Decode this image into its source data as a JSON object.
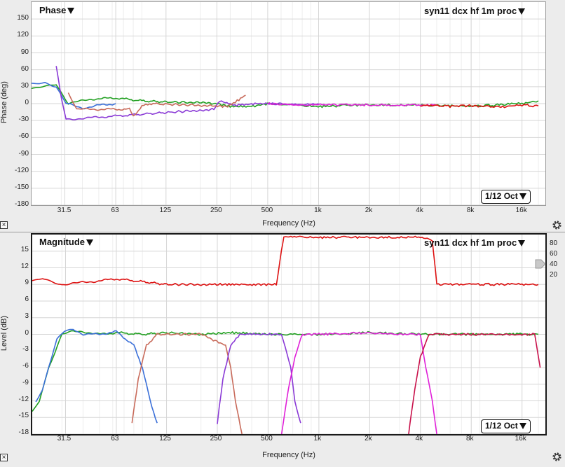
{
  "phase_panel": {
    "title": "Phase",
    "measurement": "syn11 dcx hf 1m proc",
    "smoothing": "1/12 Oct",
    "y_label": "Phase (deg)",
    "x_label": "Frequency (Hz)",
    "y_ticks": [
      "150",
      "120",
      "90",
      "60",
      "30",
      "0",
      "-30",
      "-60",
      "-90",
      "-120",
      "-150",
      "-180"
    ],
    "x_ticks": [
      "31.5",
      "63",
      "125",
      "250",
      "500",
      "1k",
      "2k",
      "4k",
      "8k",
      "16k"
    ]
  },
  "magnitude_panel": {
    "title": "Magnitude",
    "measurement": "syn11 dcx hf 1m proc",
    "smoothing": "1/12 Oct",
    "y_label": "Level (dB)",
    "x_label": "Frequency (Hz)",
    "y_ticks": [
      "15",
      "12",
      "9",
      "6",
      "3",
      "0",
      "-3",
      "-6",
      "-9",
      "-12",
      "-15",
      "-18"
    ],
    "right_ticks": [
      "80",
      "60",
      "40",
      "20"
    ],
    "x_ticks": [
      "31.5",
      "63",
      "125",
      "250",
      "500",
      "1k",
      "2k",
      "4k",
      "8k",
      "16k"
    ]
  },
  "colors": {
    "red": "#dd1111",
    "green": "#22a022",
    "blue": "#3a6fd8",
    "purple": "#8a3ad6",
    "magenta": "#e020d8",
    "salmon": "#c86a5a",
    "crimson": "#c8104a"
  },
  "chart_data": [
    {
      "type": "line",
      "title": "Phase",
      "xlabel": "Frequency (Hz)",
      "ylabel": "Phase (deg)",
      "x_scale": "log",
      "xlim": [
        20,
        22000
      ],
      "ylim": [
        -180,
        180
      ],
      "grid": true,
      "series": [
        {
          "color": "green",
          "x": [
            20,
            28,
            33,
            45,
            63,
            90,
            125,
            180,
            250,
            300,
            400,
            500,
            700,
            1000,
            2000,
            4000,
            8000,
            16000,
            20000
          ],
          "y": [
            25,
            35,
            0,
            8,
            10,
            5,
            3,
            2,
            0,
            -5,
            -5,
            0,
            -3,
            -5,
            -2,
            -3,
            -5,
            0,
            5
          ]
        },
        {
          "color": "blue",
          "x": [
            20,
            24,
            28,
            32,
            40,
            50,
            63
          ],
          "y": [
            35,
            38,
            30,
            0,
            -8,
            -3,
            0
          ]
        },
        {
          "color": "purple",
          "x": [
            28,
            30,
            32,
            240,
            260,
            280,
            320,
            400,
            500,
            800,
            1000
          ],
          "y": [
            65,
            10,
            -28,
            -10,
            5,
            2,
            -3,
            0,
            0,
            -2,
            0
          ]
        },
        {
          "color": "salmon",
          "x": [
            33,
            35,
            37,
            76,
            80,
            90,
            100,
            290,
            330,
            370
          ],
          "y": [
            20,
            5,
            -10,
            -10,
            -22,
            -5,
            0,
            -5,
            5,
            15
          ]
        },
        {
          "color": "magenta",
          "x": [
            500,
            800,
            1000,
            2000,
            3000,
            4000,
            5000
          ],
          "y": [
            0,
            -3,
            -2,
            -2,
            -3,
            -2,
            -3
          ]
        },
        {
          "color": "red",
          "x": [
            4000,
            6000,
            8000,
            12000,
            16000,
            20000
          ],
          "y": [
            -3,
            -5,
            -4,
            -6,
            -3,
            -4
          ]
        }
      ]
    },
    {
      "type": "line",
      "title": "Magnitude",
      "xlabel": "Frequency (Hz)",
      "ylabel": "Level (dB)",
      "x_scale": "log",
      "xlim": [
        20,
        22000
      ],
      "ylim": [
        -18,
        18
      ],
      "grid": true,
      "series": [
        {
          "color": "red",
          "x": [
            20,
            23,
            30,
            45,
            63,
            90,
            125,
            200,
            300,
            500,
            560,
            600,
            620,
            1000,
            2000,
            4000,
            4700,
            5000,
            8000,
            16000,
            20000
          ],
          "y": [
            9.5,
            10,
            9,
            9.5,
            10,
            9.5,
            9,
            9,
            9,
            9,
            9,
            15,
            17.5,
            17.5,
            17.5,
            17.5,
            17,
            9,
            9,
            9,
            9
          ]
        },
        {
          "color": "green",
          "x": [
            20,
            22,
            25,
            30,
            35,
            40,
            50,
            63,
            90,
            125,
            200,
            300,
            500,
            1000,
            2000,
            4000,
            8000,
            16000,
            20000
          ],
          "y": [
            -14,
            -12,
            -6,
            0,
            0.5,
            0.5,
            0,
            0.3,
            0,
            0.3,
            0,
            0.3,
            0,
            0,
            0.3,
            0,
            0,
            0,
            0
          ]
        },
        {
          "color": "blue",
          "x": [
            21,
            23,
            25,
            28,
            31,
            35,
            40,
            50,
            63,
            80,
            90,
            100,
            110
          ],
          "y": [
            -12,
            -10,
            -6,
            -1,
            0.5,
            1,
            0,
            0,
            0.5,
            -2,
            -6,
            -12,
            -16
          ]
        },
        {
          "color": "salmon",
          "x": [
            78,
            85,
            95,
            110,
            125,
            200,
            280,
            300,
            320,
            350
          ],
          "y": [
            -16,
            -8,
            -2,
            0,
            0,
            0,
            -2,
            -6,
            -12,
            -18
          ]
        },
        {
          "color": "purple",
          "x": [
            250,
            270,
            300,
            340,
            400,
            500,
            600,
            680,
            720,
            780
          ],
          "y": [
            -16,
            -8,
            -2,
            0,
            0,
            0,
            0,
            -6,
            -12,
            -16
          ]
        },
        {
          "color": "magenta",
          "x": [
            600,
            660,
            720,
            800,
            1000,
            2000,
            3000,
            4000,
            4300,
            4700,
            5000
          ],
          "y": [
            -18,
            -10,
            -4,
            0,
            0,
            0.3,
            0,
            0,
            -6,
            -12,
            -18
          ]
        },
        {
          "color": "crimson",
          "x": [
            3400,
            3700,
            4000,
            4500,
            5000,
            8000,
            16000,
            19000,
            20500
          ],
          "y": [
            -18,
            -10,
            -4,
            0,
            0,
            0,
            0,
            0,
            -6
          ]
        }
      ]
    }
  ]
}
